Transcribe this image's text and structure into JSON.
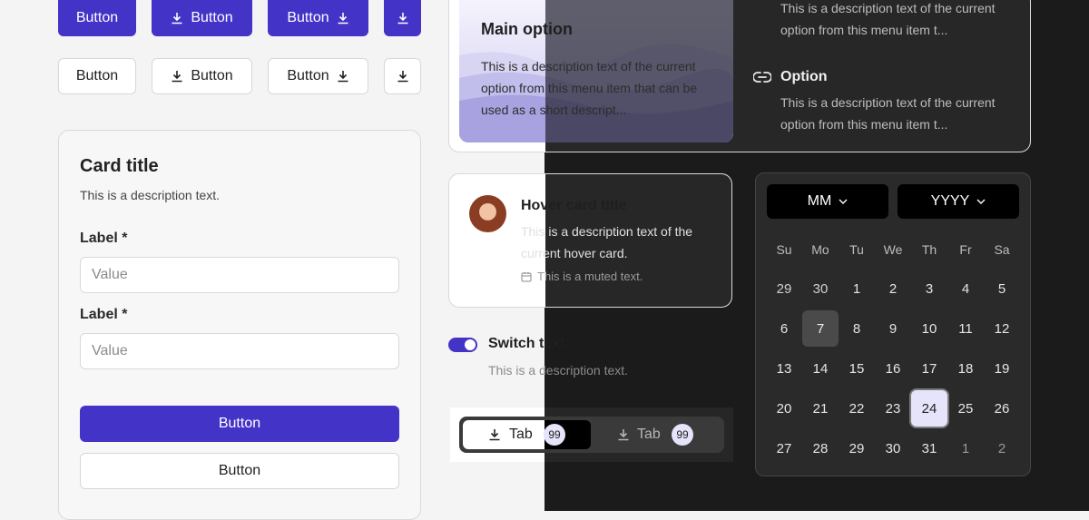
{
  "buttons": {
    "label": "Button"
  },
  "card": {
    "title": "Card title",
    "description": "This is a description text.",
    "field1": {
      "label": "Label *",
      "placeholder": "Value"
    },
    "field2": {
      "label": "Label *",
      "placeholder": "Value"
    },
    "primary_label": "Button",
    "secondary_label": "Button"
  },
  "menu": {
    "main_title": "Main option",
    "main_desc": "This is a description text of the current option from this menu item that can be used as a short descript...",
    "top_desc": "This is a description text of the current option from this menu item t...",
    "option_title": "Option",
    "option_desc": "This is a description text of the current option from this menu item t..."
  },
  "hover_card": {
    "title": "Hover card title",
    "description": "This is a description text of the current hover card.",
    "muted": "This is a muted text."
  },
  "switch": {
    "label": "Switch text",
    "description": "This is a description text.",
    "checked": true
  },
  "tabs": [
    {
      "label": "Tab",
      "badge": "99",
      "active": true
    },
    {
      "label": "Tab",
      "badge": "99",
      "active": false
    }
  ],
  "calendar": {
    "month_select": "MM",
    "year_select": "YYYY",
    "weekdays": [
      "Su",
      "Mo",
      "Tu",
      "We",
      "Th",
      "Fr",
      "Sa"
    ],
    "weeks": [
      [
        "29",
        "30",
        "1",
        "2",
        "3",
        "4",
        "5"
      ],
      [
        "6",
        "7",
        "8",
        "9",
        "10",
        "11",
        "12"
      ],
      [
        "13",
        "14",
        "15",
        "16",
        "17",
        "18",
        "19"
      ],
      [
        "20",
        "21",
        "22",
        "23",
        "24",
        "25",
        "26"
      ],
      [
        "27",
        "28",
        "29",
        "30",
        "31",
        "1",
        "2"
      ]
    ],
    "highlighted_day": "7",
    "selected_day": "24",
    "colors": {
      "accent": "#4433c7",
      "selected_bg": "#e6e4fb"
    }
  }
}
